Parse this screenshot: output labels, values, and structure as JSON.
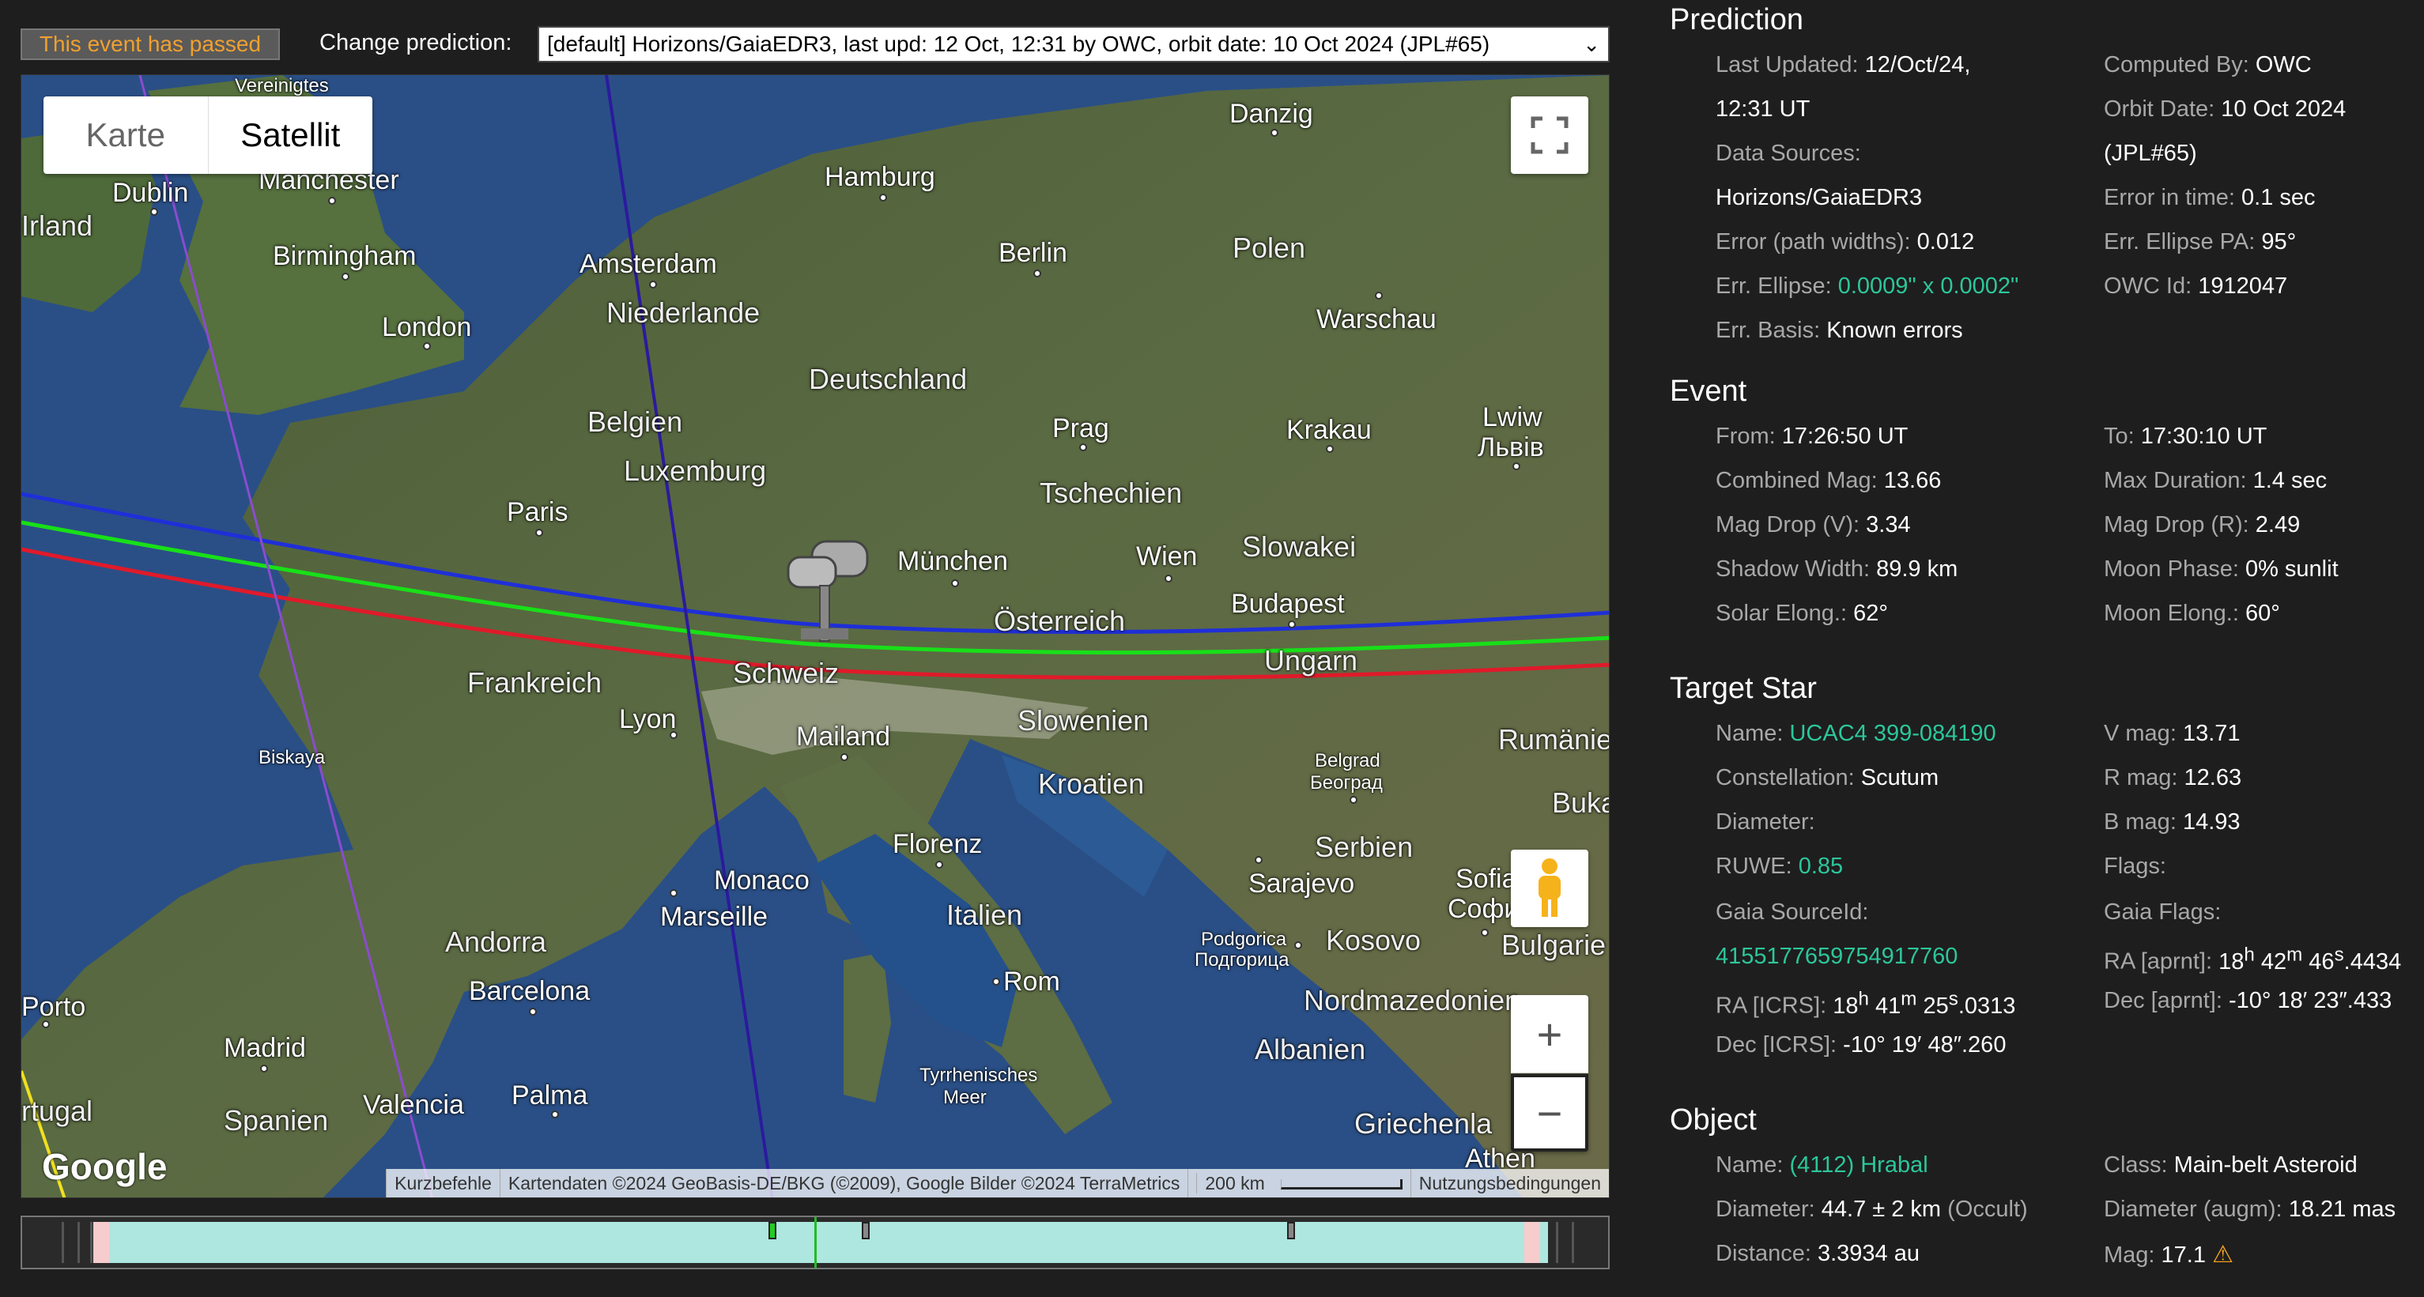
{
  "toolbar": {
    "passed_badge": "This event has passed",
    "change_label": "Change prediction:",
    "prediction_selected": "[default] Horizons/GaiaEDR3, last upd: 12 Oct, 12:31 by OWC, orbit date: 10 Oct 2024 (JPL#65)"
  },
  "map": {
    "tab_karte": "Karte",
    "tab_satellit": "Satellit",
    "google": "Google",
    "attribution": {
      "shortcuts": "Kurzbefehle",
      "data": "Kartendaten ©2024 GeoBasis-DE/BKG (©2009), Google Bilder ©2024 TerraMetrics",
      "scale": "200 km",
      "terms": "Nutzungsbedingungen"
    },
    "labels": {
      "vereinigtes": "Vereinigtes",
      "dublin": "Dublin",
      "irland": "Irland",
      "manchester": "Manchester",
      "birmingham": "Birmingham",
      "london": "London",
      "hamburg": "Hamburg",
      "danzig": "Danzig",
      "amsterdam": "Amsterdam",
      "niederlande": "Niederlande",
      "berlin": "Berlin",
      "polen": "Polen",
      "warschau": "Warschau",
      "deutschland": "Deutschland",
      "belgien": "Belgien",
      "luxemburg": "Luxemburg",
      "prag": "Prag",
      "krakau": "Krakau",
      "lwiw": "Lwiw",
      "lwiw_uk": "Львів",
      "paris": "Paris",
      "tschechien": "Tschechien",
      "muenchen": "München",
      "wien": "Wien",
      "slowakei": "Slowakei",
      "budapest": "Budapest",
      "oesterreich": "Österreich",
      "frankreich": "Frankreich",
      "schweiz": "Schweiz",
      "ungarn": "Ungarn",
      "lyon": "Lyon",
      "slowenien": "Slowenien",
      "rumaenien": "Rumänie",
      "mailand": "Mailand",
      "biskaya": "Biskaya",
      "kroatien": "Kroatien",
      "belgrad": "Belgrad",
      "belgrad_sr": "Београд",
      "buka": "Buka",
      "florenz": "Florenz",
      "serbien": "Serbien",
      "monaco": "Monaco",
      "sarajevo": "Sarajevo",
      "sofia": "Sofia",
      "sofia_bg": "София",
      "marseille": "Marseille",
      "italien": "Italien",
      "andorra": "Andorra",
      "podgorica": "Podgorica",
      "podgorica_sr": "Подгорица",
      "kosovo": "Kosovo",
      "bulgarien": "Bulgarie",
      "porto": "Porto",
      "barcelona": "Barcelona",
      "rom": "Rom",
      "nordmazedonien": "Nordmazedonien",
      "madrid": "Madrid",
      "albanien": "Albanien",
      "tyrrhenisches": "Tyrrhenisches",
      "meer": "Meer",
      "portugal": "rtugal",
      "palma": "Palma",
      "valencia": "Valencia",
      "spanien": "Spanien",
      "griechenland": "Griechenla",
      "athen": "Athen"
    }
  },
  "prediction": {
    "title": "Prediction",
    "last_updated_k": "Last Updated:",
    "last_updated_v1": "12/Oct/24,",
    "last_updated_v2": "12:31 UT",
    "computed_by_k": "Computed By:",
    "computed_by_v": "OWC",
    "orbit_date_k": "Orbit Date:",
    "orbit_date_v1": "10 Oct 2024",
    "orbit_date_v2": "(JPL#65)",
    "data_sources_k": "Data Sources:",
    "data_sources_v": "Horizons/GaiaEDR3",
    "error_time_k": "Error in time:",
    "error_time_v": "0.1 sec",
    "error_path_k": "Error (path widths):",
    "error_path_v": "0.012",
    "err_pa_k": "Err. Ellipse PA:",
    "err_pa_v": "95°",
    "err_ellipse_k": "Err. Ellipse:",
    "err_ellipse_v": "0.0009\" x 0.0002\"",
    "owc_id_k": "OWC Id:",
    "owc_id_v": "1912047",
    "err_basis_k": "Err. Basis:",
    "err_basis_v": "Known errors"
  },
  "event": {
    "title": "Event",
    "from_k": "From:",
    "from_v": "17:26:50 UT",
    "to_k": "To:",
    "to_v": "17:30:10 UT",
    "comb_mag_k": "Combined Mag:",
    "comb_mag_v": "13.66",
    "max_dur_k": "Max Duration:",
    "max_dur_v": "1.4 sec",
    "mag_drop_v_k": "Mag Drop (V):",
    "mag_drop_v_v": "3.34",
    "mag_drop_r_k": "Mag Drop (R):",
    "mag_drop_r_v": "2.49",
    "shadow_k": "Shadow Width:",
    "shadow_v": "89.9 km",
    "moon_phase_k": "Moon Phase:",
    "moon_phase_v": "0% sunlit",
    "solar_elong_k": "Solar Elong.:",
    "solar_elong_v": "62°",
    "moon_elong_k": "Moon Elong.:",
    "moon_elong_v": "60°"
  },
  "target_star": {
    "title": "Target Star",
    "name_k": "Name:",
    "name_v": "UCAC4 399-084190",
    "vmag_k": "V mag:",
    "vmag_v": "13.71",
    "const_k": "Constellation:",
    "const_v": "Scutum",
    "rmag_k": "R mag:",
    "rmag_v": "12.63",
    "diam_k": "Diameter:",
    "bmag_k": "B mag:",
    "bmag_v": "14.93",
    "ruwe_k": "RUWE:",
    "ruwe_v": "0.85",
    "flags_k": "Flags:",
    "gaia_src_k": "Gaia SourceId:",
    "gaia_flags_k": "Gaia Flags:",
    "gaia_src_v": "4155177659754917760",
    "ra_aprnt_k": "RA [aprnt]:",
    "ra_aprnt_h": "18",
    "ra_aprnt_m": "42",
    "ra_aprnt_s": "46",
    "ra_aprnt_f": ".4434",
    "ra_icrs_k": "RA [ICRS]:",
    "ra_icrs_h": "18",
    "ra_icrs_m": "41",
    "ra_icrs_s": "25",
    "ra_icrs_f": ".0313",
    "dec_aprnt_k": "Dec [aprnt]:",
    "dec_aprnt_v": "-10° 18′ 23″.433",
    "dec_icrs_k": "Dec [ICRS]:",
    "dec_icrs_v": "-10° 19′ 48″.260"
  },
  "object": {
    "title": "Object",
    "name_k": "Name:",
    "name_v": "(4112) Hrabal",
    "class_k": "Class:",
    "class_v": "Main-belt Asteroid",
    "diam_k": "Diameter:",
    "diam_v": "44.7 ± 2 km",
    "diam_note": "(Occult)",
    "diam_augm_k": "Diameter (augm):",
    "diam_augm_v": "18.21 mas",
    "dist_k": "Distance:",
    "dist_v": "3.3934 au",
    "mag_k": "Mag:",
    "mag_v": "17.1"
  },
  "colors": {
    "accent_green": "#2cc79a",
    "passed_orange": "#f0a030",
    "path_blue": "#1f2fd8",
    "path_green": "#18e018",
    "path_red": "#e01a2a"
  }
}
